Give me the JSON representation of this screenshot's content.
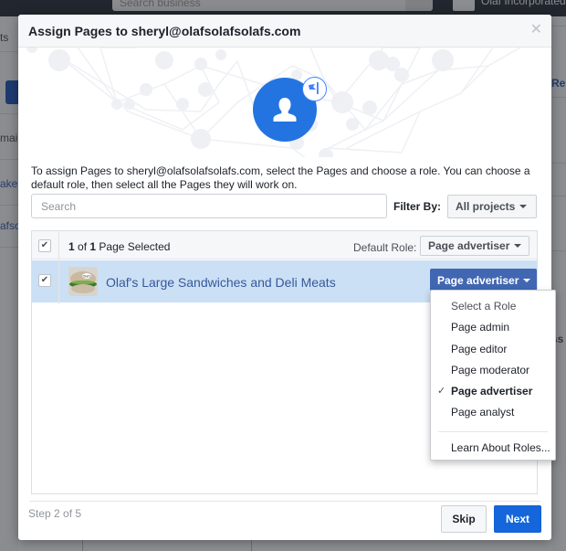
{
  "background": {
    "search_placeholder": "Search business",
    "business_name": "Olaf Incorporated",
    "left_fragments": [
      "ts",
      "mai",
      "ake",
      "afso"
    ],
    "right_fragments": [
      "Res",
      "ss"
    ]
  },
  "modal": {
    "title": "Assign Pages to sheryl@olafsolafsolafs.com",
    "close_icon": "close-icon",
    "hero_icon": "person-icon",
    "badge_icon": "flag-icon",
    "intro": "To assign Pages to sheryl@olafsolafsolafs.com, select the Pages and choose a role. You can choose a default role, then select all the Pages they will work on.",
    "search": {
      "placeholder": "Search",
      "value": ""
    },
    "filter": {
      "label": "Filter By:",
      "selected": "All projects"
    },
    "table": {
      "header": {
        "selected_num": "1",
        "of_text": " of ",
        "total_num": "1",
        "suffix": " Page Selected",
        "all_checked": true,
        "default_role_label": "Default Role:",
        "default_role_value": "Page advertiser"
      },
      "rows": [
        {
          "checked": true,
          "name": "Olaf's Large Sandwiches and Deli Meats",
          "role": "Page advertiser",
          "thumb_label": "Olaf's"
        }
      ]
    },
    "role_menu": {
      "items": [
        {
          "label": "Select a Role",
          "selected": false,
          "muted": true
        },
        {
          "label": "Page admin",
          "selected": false
        },
        {
          "label": "Page editor",
          "selected": false
        },
        {
          "label": "Page moderator",
          "selected": false
        },
        {
          "label": "Page advertiser",
          "selected": true
        },
        {
          "label": "Page analyst",
          "selected": false
        }
      ],
      "learn_more": "Learn About Roles..."
    },
    "footer": {
      "step": "Step 2 of 5",
      "skip": "Skip",
      "next": "Next"
    }
  },
  "colors": {
    "primary": "#1466da",
    "role_button": "#4267b2",
    "selected_row": "#cce0f5",
    "link": "#365899"
  }
}
